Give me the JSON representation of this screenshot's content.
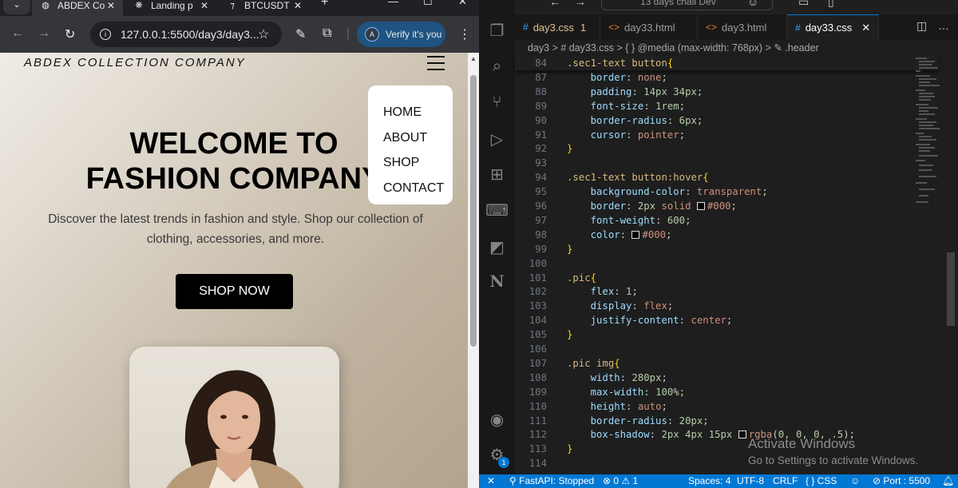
{
  "browser": {
    "tabs": [
      {
        "title": "ABDEX Co",
        "icon": "globe-icon",
        "active": true
      },
      {
        "title": "Landing p",
        "icon": "openai-icon",
        "active": false
      },
      {
        "title": "BTCUSDT",
        "icon": "tradingview-icon",
        "active": false
      }
    ],
    "new_tab": "+",
    "url": "127.0.0.1:5500/day3/day3...",
    "profile_initial": "A",
    "verify_label": "Verify it's you"
  },
  "site": {
    "brand": "ABDEX COLLECTION COMPANY",
    "menu": [
      "HOME",
      "ABOUT",
      "SHOP",
      "CONTACT"
    ],
    "hero_title_1": "WELCOME TO",
    "hero_title_2": "FASHION COMPANY",
    "hero_subtitle": "Discover the latest trends in fashion and style. Shop our collection of clothing, accessories, and more.",
    "cta": "SHOP NOW"
  },
  "vscode": {
    "search_text": "13 days chall Dev",
    "tabs": [
      {
        "label": "day3.css",
        "badge": "1",
        "icon": "#",
        "active": false
      },
      {
        "label": "day33.html",
        "badge": "",
        "icon": "<>",
        "active": false
      },
      {
        "label": "day3.html",
        "badge": "",
        "icon": "<>",
        "active": false
      },
      {
        "label": "day33.css",
        "badge": "",
        "icon": "#",
        "active": true
      }
    ],
    "breadcrumb": "day3 > # day33.css > { } @media (max-width: 768px) > ✎ .header",
    "lines": [
      {
        "n": "84",
        "t": "sticky",
        "parts": [
          [
            "sel",
            ".sec1-text button"
          ],
          [
            "br",
            "{"
          ]
        ]
      },
      {
        "n": "87",
        "parts": [
          [
            "prop",
            "    border"
          ],
          [
            "pun",
            ": "
          ],
          [
            "val",
            "none"
          ],
          [
            "pun",
            ";"
          ]
        ]
      },
      {
        "n": "88",
        "parts": [
          [
            "prop",
            "    padding"
          ],
          [
            "pun",
            ": "
          ],
          [
            "num",
            "14px 34px"
          ],
          [
            "pun",
            ";"
          ]
        ]
      },
      {
        "n": "89",
        "parts": [
          [
            "prop",
            "    font-size"
          ],
          [
            "pun",
            ": "
          ],
          [
            "num",
            "1rem"
          ],
          [
            "pun",
            ";"
          ]
        ]
      },
      {
        "n": "90",
        "parts": [
          [
            "prop",
            "    border-radius"
          ],
          [
            "pun",
            ": "
          ],
          [
            "num",
            "6px"
          ],
          [
            "pun",
            ";"
          ]
        ]
      },
      {
        "n": "91",
        "parts": [
          [
            "prop",
            "    cursor"
          ],
          [
            "pun",
            ": "
          ],
          [
            "val",
            "pointer"
          ],
          [
            "pun",
            ";"
          ]
        ]
      },
      {
        "n": "92",
        "parts": [
          [
            "br",
            "}"
          ]
        ]
      },
      {
        "n": "93",
        "parts": []
      },
      {
        "n": "94",
        "parts": [
          [
            "sel",
            ".sec1-text button:hover"
          ],
          [
            "br",
            "{"
          ]
        ]
      },
      {
        "n": "95",
        "parts": [
          [
            "prop",
            "    background-color"
          ],
          [
            "pun",
            ": "
          ],
          [
            "val",
            "transparent"
          ],
          [
            "pun",
            ";"
          ]
        ]
      },
      {
        "n": "96",
        "parts": [
          [
            "prop",
            "    border"
          ],
          [
            "pun",
            ": "
          ],
          [
            "num",
            "2px"
          ],
          [
            "pun",
            " "
          ],
          [
            "val",
            "solid "
          ],
          [
            "sw",
            "#000"
          ],
          [
            "val",
            "#000"
          ],
          [
            "pun",
            ";"
          ]
        ]
      },
      {
        "n": "97",
        "parts": [
          [
            "prop",
            "    font-weight"
          ],
          [
            "pun",
            ": "
          ],
          [
            "num",
            "600"
          ],
          [
            "pun",
            ";"
          ]
        ]
      },
      {
        "n": "98",
        "parts": [
          [
            "prop",
            "    color"
          ],
          [
            "pun",
            ": "
          ],
          [
            "sw",
            "#000"
          ],
          [
            "val",
            "#000"
          ],
          [
            "pun",
            ";"
          ]
        ]
      },
      {
        "n": "99",
        "parts": [
          [
            "br",
            "}"
          ]
        ]
      },
      {
        "n": "100",
        "parts": []
      },
      {
        "n": "101",
        "parts": [
          [
            "sel",
            ".pic"
          ],
          [
            "br",
            "{"
          ]
        ]
      },
      {
        "n": "102",
        "parts": [
          [
            "prop",
            "    flex"
          ],
          [
            "pun",
            ": "
          ],
          [
            "num",
            "1"
          ],
          [
            "pun",
            ";"
          ]
        ]
      },
      {
        "n": "103",
        "parts": [
          [
            "prop",
            "    display"
          ],
          [
            "pun",
            ": "
          ],
          [
            "val",
            "flex"
          ],
          [
            "pun",
            ";"
          ]
        ]
      },
      {
        "n": "104",
        "parts": [
          [
            "prop",
            "    justify-content"
          ],
          [
            "pun",
            ": "
          ],
          [
            "val",
            "center"
          ],
          [
            "pun",
            ";"
          ]
        ]
      },
      {
        "n": "105",
        "parts": [
          [
            "br",
            "}"
          ]
        ]
      },
      {
        "n": "106",
        "parts": []
      },
      {
        "n": "107",
        "parts": [
          [
            "sel",
            ".pic img"
          ],
          [
            "br",
            "{"
          ]
        ]
      },
      {
        "n": "108",
        "parts": [
          [
            "prop",
            "    width"
          ],
          [
            "pun",
            ": "
          ],
          [
            "num",
            "280px"
          ],
          [
            "pun",
            ";"
          ]
        ]
      },
      {
        "n": "109",
        "parts": [
          [
            "prop",
            "    max-width"
          ],
          [
            "pun",
            ": "
          ],
          [
            "num",
            "100%"
          ],
          [
            "pun",
            ";"
          ]
        ]
      },
      {
        "n": "110",
        "parts": [
          [
            "prop",
            "    height"
          ],
          [
            "pun",
            ": "
          ],
          [
            "val",
            "auto"
          ],
          [
            "pun",
            ";"
          ]
        ]
      },
      {
        "n": "111",
        "parts": [
          [
            "prop",
            "    border-radius"
          ],
          [
            "pun",
            ": "
          ],
          [
            "num",
            "20px"
          ],
          [
            "pun",
            ";"
          ]
        ]
      },
      {
        "n": "112",
        "parts": [
          [
            "prop",
            "    box-shadow"
          ],
          [
            "pun",
            ": "
          ],
          [
            "num",
            "2px 4px 15px "
          ],
          [
            "sw",
            "rgba(0,0,0,.5)"
          ],
          [
            "val",
            "rgba"
          ],
          [
            "pun",
            "("
          ],
          [
            "num",
            "0, 0, 0, .5"
          ],
          [
            "pun",
            ");"
          ]
        ]
      },
      {
        "n": "113",
        "parts": [
          [
            "br",
            "}"
          ]
        ]
      },
      {
        "n": "114",
        "parts": []
      }
    ],
    "watermark_1": "Activate Windows",
    "watermark_2": "Go to Settings to activate Windows.",
    "status": {
      "remote": "✕",
      "fastapi": "FastAPI: Stopped",
      "problems": "⊗ 0 ⚠ 1",
      "spaces": "Spaces: 4",
      "encoding": "UTF-8",
      "eol": "CRLF",
      "language": "{ } CSS",
      "port": "⊘ Port : 5500"
    },
    "accounts_badge": "1"
  },
  "colors": {
    "vscode_accent": "#0078d4",
    "selector": "#d7ba7d",
    "property": "#9cdcfe",
    "value": "#ce9178",
    "number": "#b5cea8"
  }
}
